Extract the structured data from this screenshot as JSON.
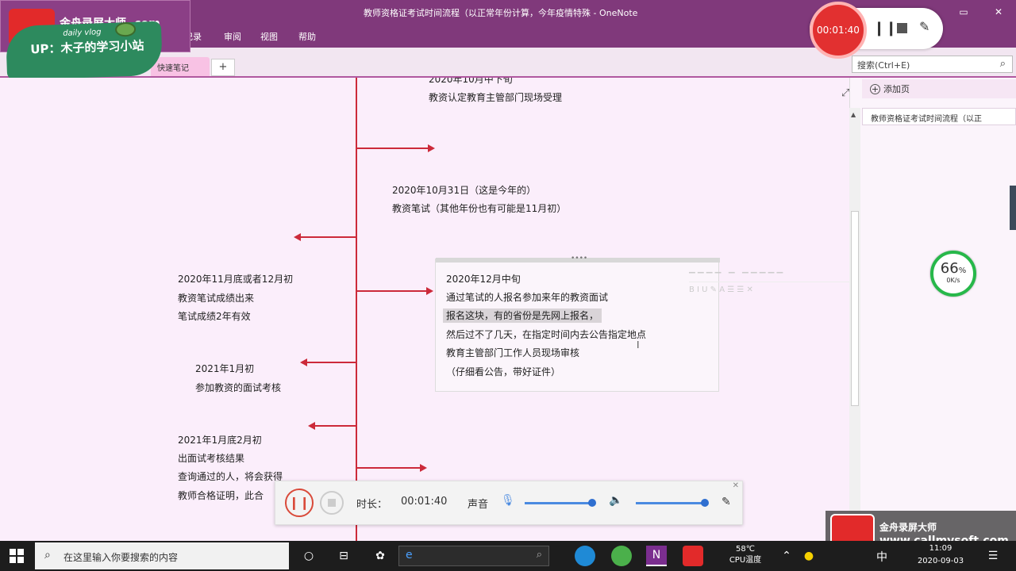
{
  "window": {
    "title": "教师资格证考试时间流程（以正常年份计算，今年疫情特殊 - OneNote",
    "controls": [
      "—",
      "⧉",
      "▭",
      "✕"
    ]
  },
  "ribbon": {
    "tabs": [
      "历史记录",
      "审阅",
      "视图",
      "帮助"
    ]
  },
  "sections": {
    "active": "快速笔记",
    "add": "+"
  },
  "search": {
    "placeholder": "搜索(Ctrl+E)"
  },
  "overlay": {
    "logo_text": "金舟录屏大师 .com",
    "daily_vlog": "daily vlog",
    "up_text": "UP：木子的学习小站"
  },
  "recorder_top": {
    "time": "00:01:40"
  },
  "timeline": {
    "top_partial": "2020年10月中下旬",
    "top_text": "教资认定教育主管部门现场受理",
    "item_oct31": [
      "2020年10月31日（这是今年的）",
      "教资笔试（其他年份也有可能是11月初）"
    ],
    "item_novdec": [
      "2020年11月底或者12月初",
      "教资笔试成绩出来",
      "笔试成绩2年有效"
    ],
    "item_jan": [
      "2021年1月初",
      "参加教资的面试考核"
    ],
    "item_jan_feb": [
      "2021年1月底2月初",
      "出面试考核结果",
      "查询通过的人，将会获得",
      "教师合格证明，此合"
    ],
    "notebox": {
      "lines": [
        "2020年12月中旬",
        "通过笔试的人报名参加来年的教资面试",
        "报名这块，有的省份是先网上报名，",
        "然后过不了几天，在指定时间内去公告指定地点",
        "教育主管部门工作人员现场审核",
        "（仔细看公告，带好证件）"
      ]
    }
  },
  "right_pane": {
    "add_page": "添加页",
    "page_item": "教师资格证考试时间流程（以正"
  },
  "net_speed": {
    "percent": "66",
    "unit": "%",
    "rate": "0K/s"
  },
  "recorder_bar": {
    "duration_label": "时长：",
    "duration": "00:01:40",
    "sound_label": "声音"
  },
  "watermark": {
    "line1": "金舟录屏大师",
    "line2": "www.callmysoft.com"
  },
  "taskbar": {
    "search_placeholder": "在这里输入你要搜索的内容",
    "temp": "58℃",
    "temp_label": "CPU温度",
    "ime": "中",
    "time": "11:09",
    "date": "2020-09-03"
  },
  "colors": {
    "onenote_purple": "#80397b",
    "timeline_red": "#cc2a3a",
    "canvas_bg": "#fbeefb"
  }
}
